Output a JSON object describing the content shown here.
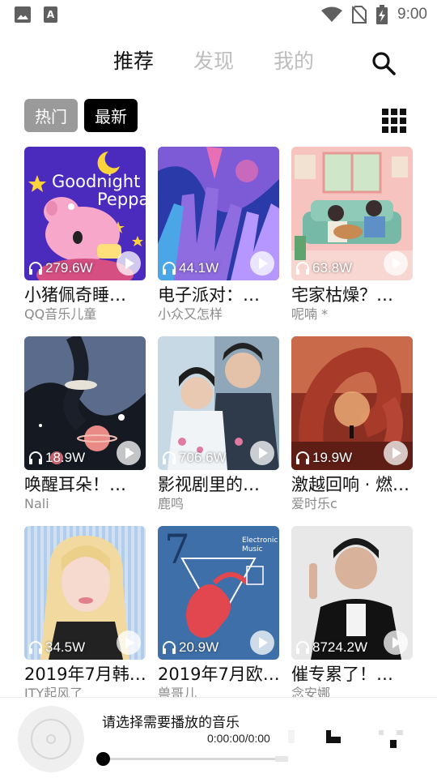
{
  "status_bar": {
    "time": "9:00",
    "left_icons": [
      "image-icon",
      "text-a-icon"
    ],
    "right_icons": [
      "wifi-icon",
      "no-sim-icon",
      "battery-charging-icon"
    ]
  },
  "top_tabs": [
    {
      "label": "推荐",
      "active": true
    },
    {
      "label": "发现",
      "active": false
    },
    {
      "label": "我的",
      "active": false
    }
  ],
  "filter_chips": [
    {
      "label": "热门",
      "active": false
    },
    {
      "label": "最新",
      "active": true
    }
  ],
  "playlists": [
    {
      "title": "小猪佩奇睡…",
      "author": "QQ音乐儿童",
      "plays": "279.6W",
      "cover": "peppa"
    },
    {
      "title": "电子派对：…",
      "author": "小众又怎样",
      "plays": "44.1W",
      "cover": "hands"
    },
    {
      "title": "宅家枯燥？…",
      "author": "呢喃 *",
      "plays": "63.8W",
      "cover": "room"
    },
    {
      "title": "唤醒耳朵！…",
      "author": "Nali",
      "plays": "18.9W",
      "cover": "space"
    },
    {
      "title": "影视剧里的…",
      "author": "鹿鸣",
      "plays": "706.6W",
      "cover": "drama"
    },
    {
      "title": "激越回响 · 燃…",
      "author": "爱时乐c",
      "plays": "19.9W",
      "cover": "tentacle"
    },
    {
      "title": "2019年7月韩…",
      "author": "JTY起风了",
      "plays": "34.5W",
      "cover": "kpop"
    },
    {
      "title": "2019年7月欧…",
      "author": "兽哥儿",
      "plays": "20.9W",
      "cover": "electronic"
    },
    {
      "title": "催专累了！…",
      "author": "念安娜",
      "plays": "8724.2W",
      "cover": "singer"
    }
  ],
  "player": {
    "title": "请选择需要播放的音乐",
    "time": "0:00:00/0:00",
    "progress": 0
  },
  "colors": {
    "accent": "#000000",
    "inactive_tab": "#bdbdbd",
    "chip_inactive": "#9a9a9a",
    "author_gray": "#8a8a8a"
  }
}
